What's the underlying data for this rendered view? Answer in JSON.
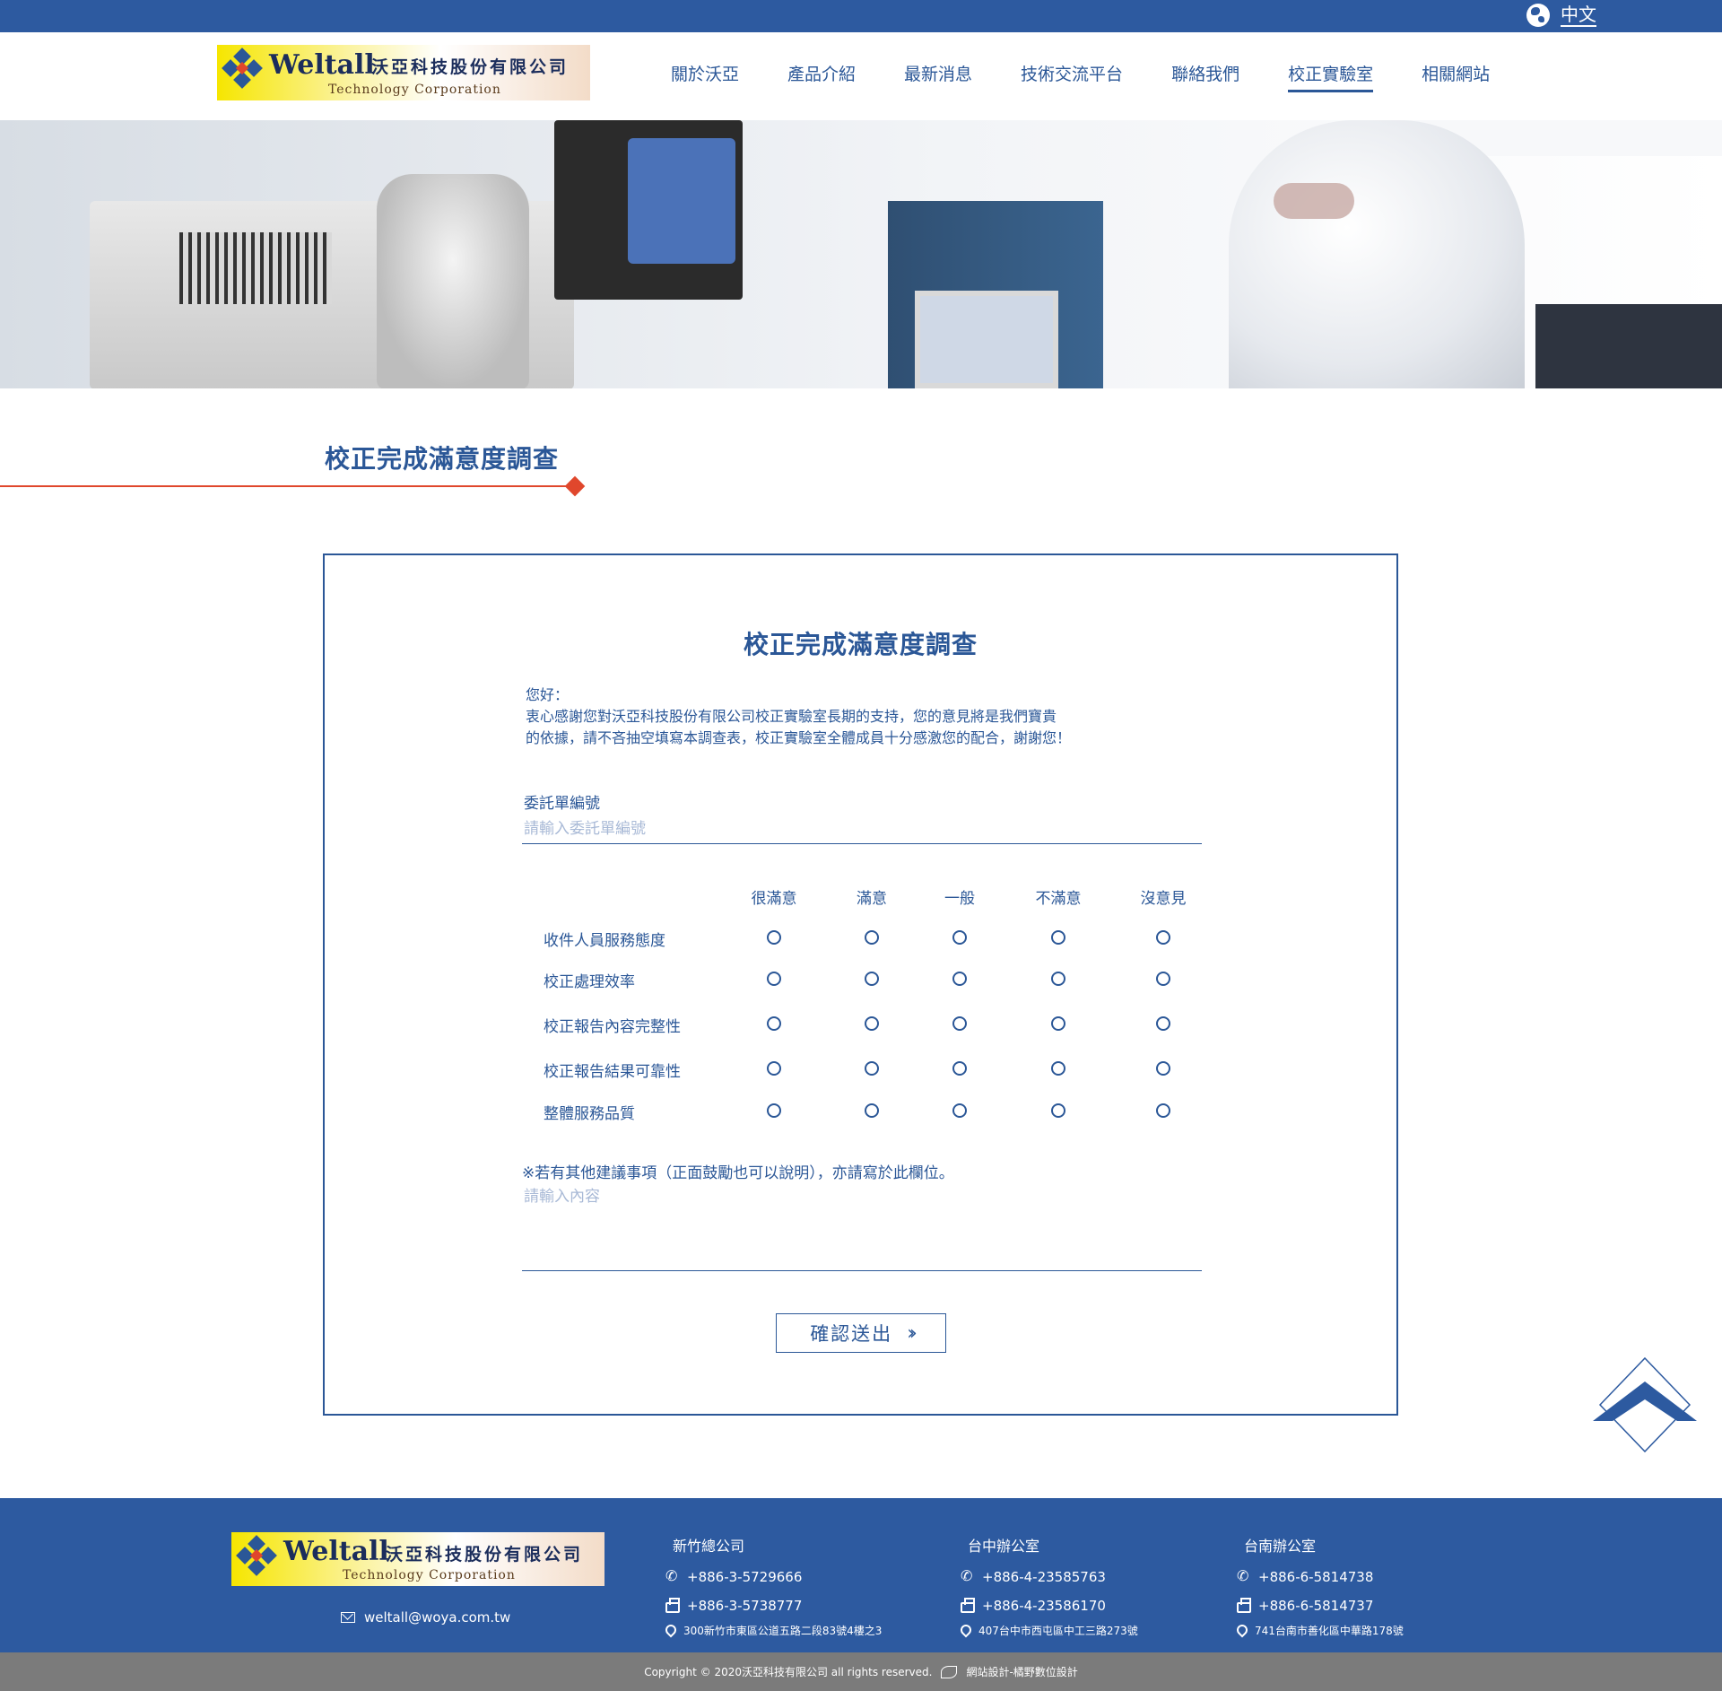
{
  "topbar": {
    "language_label": "中文",
    "accent_color": "#2d5aa0"
  },
  "logo": {
    "en": "Weltall",
    "zh": "沃亞科技股份有限公司",
    "sub": "Technology Corporation"
  },
  "nav": {
    "items": [
      {
        "label": "關於沃亞"
      },
      {
        "label": "產品介紹"
      },
      {
        "label": "最新消息"
      },
      {
        "label": "技術交流平台"
      },
      {
        "label": "聯絡我們"
      },
      {
        "label": "校正實驗室"
      },
      {
        "label": "相關網站"
      }
    ],
    "active": "校正實驗室"
  },
  "page": {
    "title": "校正完成滿意度調查",
    "title_accent": "#e0472c"
  },
  "form": {
    "title": "校正完成滿意度調查",
    "intro": {
      "line1": "您好：",
      "line2": "衷心感謝您對沃亞科技股份有限公司校正實驗室長期的支持，您的意見將是我們寶貴",
      "line3": "的依據，請不吝抽空填寫本調查表，校正實驗室全體成員十分感激您的配合，謝謝您！"
    },
    "order_no": {
      "label": "委託單編號",
      "placeholder": "請輸入委託單編號",
      "value": ""
    },
    "rating_columns": [
      "很滿意",
      "滿意",
      "一般",
      "不滿意",
      "沒意見"
    ],
    "rating_rows": [
      "收件人員服務態度",
      "校正處理效率",
      "校正報告內容完整性",
      "校正報告結果可靠性",
      "整體服務品質"
    ],
    "note": "※若有其他建議事項（正面鼓勵也可以說明），亦請寫於此欄位。",
    "comment": {
      "placeholder": "請輸入內容",
      "value": ""
    },
    "submit_label": "確認送出"
  },
  "footer": {
    "email": "weltall@woya.com.tw",
    "offices": [
      {
        "name": "新竹總公司",
        "tel": "+886-3-5729666",
        "fax": "+886-3-5738777",
        "address": "300新竹市東區公道五路二段83號4樓之3"
      },
      {
        "name": "台中辦公室",
        "tel": "+886-4-23585763",
        "fax": "+886-4-23586170",
        "address": "407台中市西屯區中工三路273號"
      },
      {
        "name": "台南辦公室",
        "tel": "+886-6-5814738",
        "fax": "+886-6-5814737",
        "address": "741台南市善化區中華路178號"
      }
    ],
    "copyright": "Copyright © 2020沃亞科技有限公司 all rights reserved.",
    "designer": "網站設計-橘野數位設計",
    "background_color": "#2d5aa0",
    "copy_bar_color": "#7b7b7b"
  }
}
